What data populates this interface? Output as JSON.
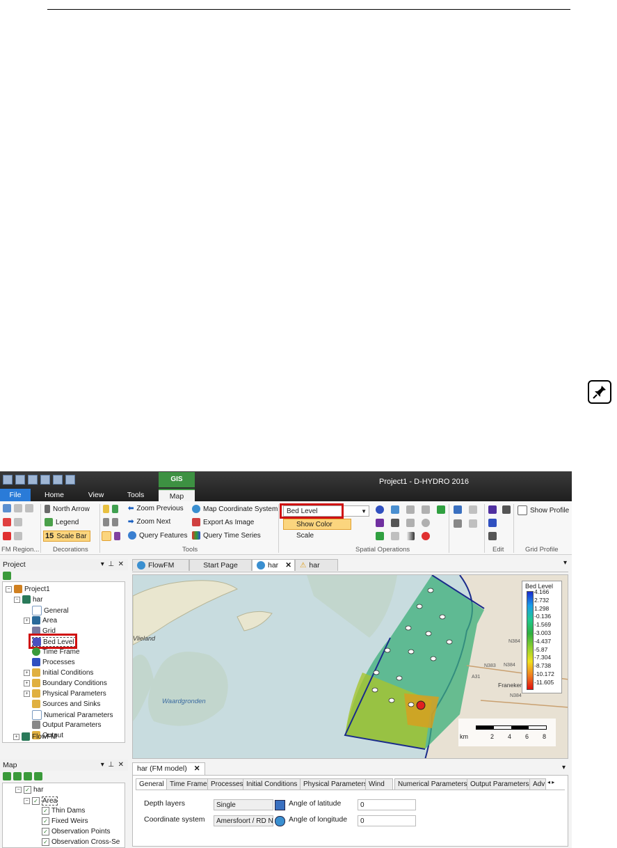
{
  "window": {
    "title": "Project1 - D-HYDRO 2016"
  },
  "ribbon": {
    "tabs": {
      "file": "File",
      "home": "Home",
      "view": "View",
      "tools": "Tools",
      "gis": "GIS",
      "map": "Map"
    },
    "fm_region_label": "FM Region...",
    "decorations": {
      "north_arrow": "North Arrow",
      "legend": "Legend",
      "scale_bar": "Scale Bar",
      "group": "Decorations"
    },
    "tools": {
      "zoom_previous": "Zoom Previous",
      "zoom_next": "Zoom Next",
      "query_features": "Query Features",
      "map_coordinate_system": "Map Coordinate System",
      "export_as_image": "Export As Image",
      "query_time_series": "Query Time Series",
      "group": "Tools"
    },
    "spatial": {
      "dropdown_value": "Bed Level",
      "show_color_scale": "Show Color Scale",
      "group": "Spatial Operations"
    },
    "edit_group": "Edit",
    "grid_profile": {
      "show_profile": "Show Profile",
      "group": "Grid Profile"
    }
  },
  "project_panel": {
    "title": "Project",
    "items": {
      "project1": "Project1",
      "har": "har",
      "general": "General",
      "area": "Area",
      "grid": "Grid",
      "bed_level": "Bed Level",
      "time_frame": "Time Frame",
      "processes": "Processes",
      "initial_conditions": "Initial Conditions",
      "boundary_conditions": "Boundary Conditions",
      "physical_parameters": "Physical Parameters",
      "sources_and_sinks": "Sources and Sinks",
      "numerical_parameters": "Numerical Parameters",
      "output_parameters": "Output Parameters",
      "output": "Output",
      "flowfm": "FlowFM"
    }
  },
  "map_panel": {
    "title": "Map",
    "layers": {
      "har": "har",
      "area": "Area",
      "thin_dams": "Thin Dams",
      "fixed_weirs": "Fixed Weirs",
      "observation_points": "Observation Points",
      "observation_cross": "Observation Cross-Se"
    }
  },
  "document_tabs": {
    "flowfm": "FlowFM",
    "start_page": "Start Page",
    "har": "har",
    "har2": "har"
  },
  "map": {
    "labels": {
      "vlieland": "Vlieland",
      "waardgronden": "Waardgronden",
      "franeker": "Franeker",
      "n384a": "N384",
      "n383": "N383",
      "n384b": "N384",
      "a31": "A31",
      "n384c": "N384"
    },
    "legend": {
      "title": "Bed Level",
      "values": [
        "4.166",
        "2.732",
        "1.298",
        "-0.136",
        "-1.569",
        "-3.003",
        "-4.437",
        "-5.87",
        "-7.304",
        "-8.738",
        "-10.172",
        "-11.605"
      ]
    },
    "scalebar": {
      "unit": "km",
      "ticks": [
        "2",
        "4",
        "6",
        "8"
      ]
    }
  },
  "properties": {
    "title": "har (FM model)",
    "tabs": [
      "General",
      "Time Frame",
      "Processes",
      "Initial Conditions",
      "Physical Parameters",
      "Wind",
      "Numerical Parameters",
      "Output Parameters",
      "Adv"
    ],
    "depth_layers_label": "Depth layers",
    "depth_layers_value": "Single",
    "coordinate_system_label": "Coordinate system",
    "coordinate_system_value": "Amersfoort / RD N",
    "angle_latitude_label": "Angle of latitude",
    "angle_latitude_value": "0",
    "angle_longitude_label": "Angle of longitude",
    "angle_longitude_value": "0"
  }
}
